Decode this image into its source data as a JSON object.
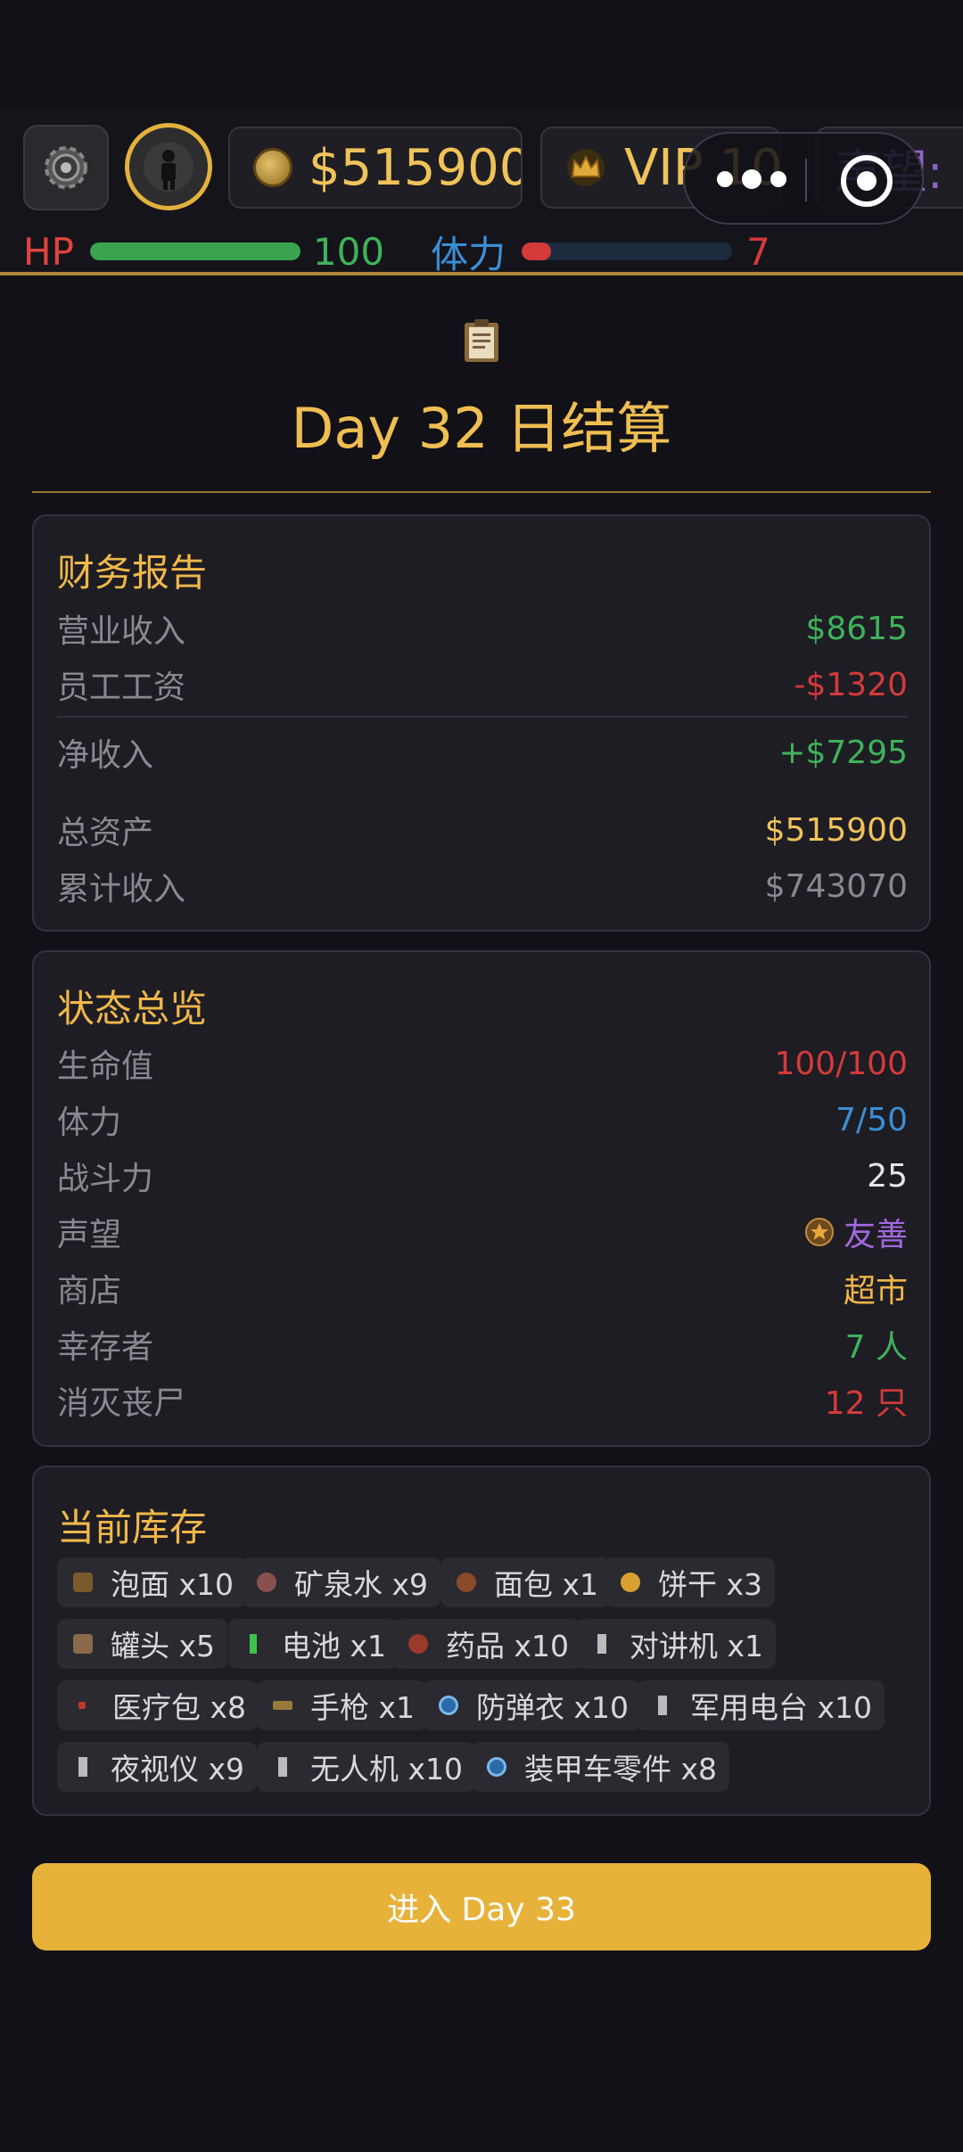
{
  "header": {
    "money": "$515900",
    "vip": "VIP 10",
    "reputation_label": "声望:",
    "hp_label": "HP",
    "hp_value": "100",
    "hp_fraction": 1.0,
    "stamina_label": "体力",
    "stamina_value": "7",
    "stamina_fraction": 0.14
  },
  "icons": {
    "settings": "gear-icon",
    "avatar": "soldier-avatar-icon",
    "money": "coin-icon",
    "vip": "crown-icon",
    "menu": "more-dots-icon",
    "close": "target-close-icon",
    "report": "clipboard-icon",
    "reputation": "star-medal-icon"
  },
  "title": "Day 32 日结算",
  "finance": {
    "heading": "财务报告",
    "revenue_label": "营业收入",
    "revenue_value": "$8615",
    "wages_label": "员工工资",
    "wages_value": "-$1320",
    "net_label": "净收入",
    "net_value": "+$7295",
    "assets_label": "总资产",
    "assets_value": "$515900",
    "cumulative_label": "累计收入",
    "cumulative_value": "$743070"
  },
  "status": {
    "heading": "状态总览",
    "hp_label": "生命值",
    "hp_value": "100/100",
    "stamina_label": "体力",
    "stamina_value": "7/50",
    "combat_label": "战斗力",
    "combat_value": "25",
    "reputation_label": "声望",
    "reputation_value": "友善",
    "shop_label": "商店",
    "shop_value": "超市",
    "survivors_label": "幸存者",
    "survivors_value": "7 人",
    "zombies_label": "消灭丧尸",
    "zombies_value": "12 只"
  },
  "inventory": {
    "heading": "当前库存",
    "items": [
      "泡面 x10",
      "矿泉水 x9",
      "面包 x1",
      "饼干 x3",
      "罐头 x5",
      "电池 x1",
      "药品 x10",
      "对讲机 x1",
      "医疗包 x8",
      "手枪 x1",
      "防弹衣 x10",
      "军用电台 x10",
      "夜视仪 x9",
      "无人机 x10",
      "装甲车零件 x8"
    ]
  },
  "cta_label": "进入 Day 33",
  "colors": {
    "background": "#121117",
    "card": "#1e1d24",
    "accent": "#efb84a",
    "green": "#3fb25b",
    "red": "#d43a3a",
    "blue": "#3a8fd6",
    "purple": "#8c63c8",
    "button": "#e7b23a"
  }
}
